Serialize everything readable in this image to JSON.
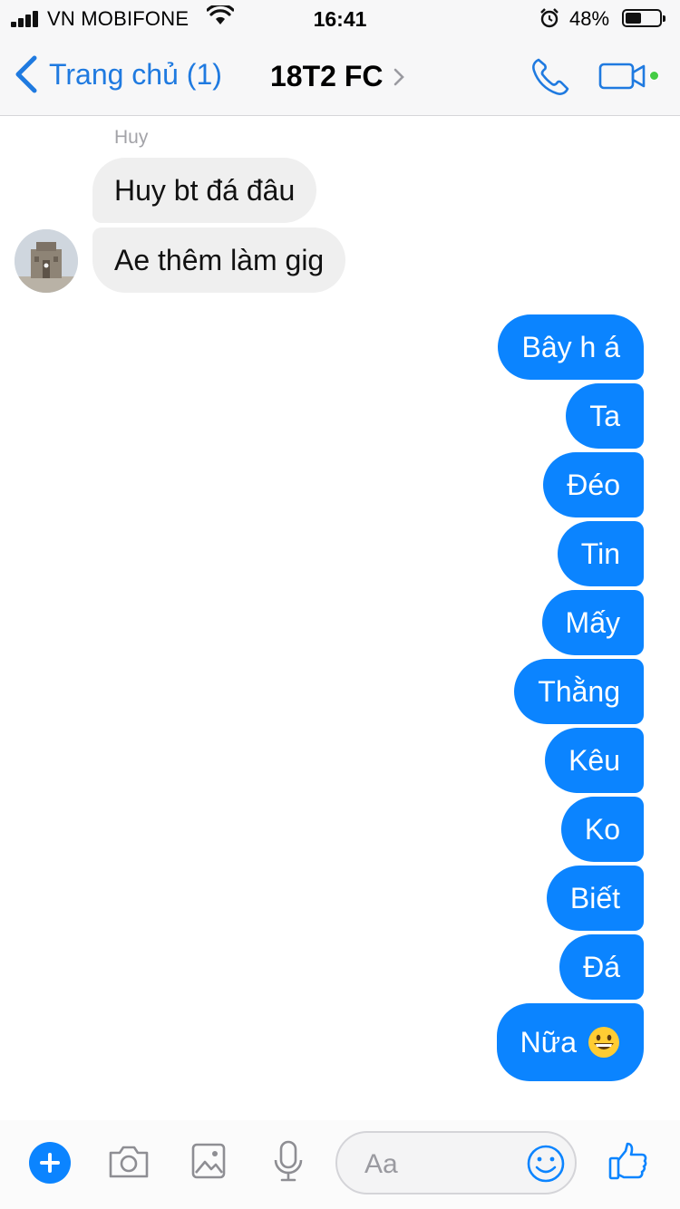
{
  "status_bar": {
    "carrier": "VN MOBIFONE",
    "time": "16:41",
    "battery_percent": "48%",
    "battery_level": 0.48
  },
  "nav": {
    "back_label": "Trang chủ (1)",
    "title": "18T2 FC"
  },
  "conversation": {
    "incoming": {
      "sender": "Huy",
      "messages": [
        "Huy bt đá đâu",
        "Ae thêm làm gig"
      ]
    },
    "outgoing": [
      "Bây h á",
      "Ta",
      "Đéo",
      "Tin",
      "Mấy",
      "Thằng",
      "Kêu",
      "Ko",
      "Biết",
      "Đá",
      "Nữa"
    ]
  },
  "composer": {
    "placeholder": "Aa"
  },
  "colors": {
    "accent": "#0b84ff",
    "incoming_bubble": "#efefef",
    "online": "#44cc44"
  },
  "icons": [
    "back-chevron-icon",
    "phone-icon",
    "video-camera-icon",
    "plus-icon",
    "camera-icon",
    "gallery-icon",
    "microphone-icon",
    "smiley-icon",
    "thumbs-up-icon"
  ]
}
